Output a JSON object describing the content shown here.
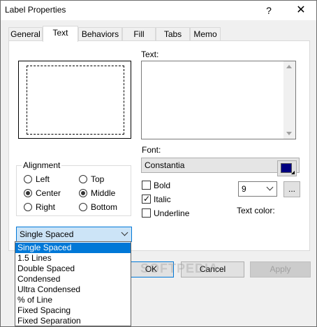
{
  "window": {
    "title": "Label Properties",
    "help_label": "?",
    "close_label": "✕"
  },
  "tabs": [
    {
      "label": "General"
    },
    {
      "label": "Text"
    },
    {
      "label": "Behaviors"
    },
    {
      "label": "Fill"
    },
    {
      "label": "Tabs"
    },
    {
      "label": "Memo"
    }
  ],
  "active_tab": "Text",
  "text_section": {
    "label": "Text:",
    "value": ""
  },
  "alignment": {
    "title": "Alignment",
    "options": {
      "left": "Left",
      "top": "Top",
      "center": "Center",
      "middle": "Middle",
      "right": "Right",
      "bottom": "Bottom"
    },
    "selected_horizontal": "Center",
    "selected_vertical": "Middle"
  },
  "font": {
    "label": "Font:",
    "name": "Constantia",
    "size": "9",
    "browse_label": "...",
    "bold_label": "Bold",
    "bold_checked": false,
    "italic_label": "Italic",
    "italic_checked": true,
    "underline_label": "Underline",
    "underline_checked": false,
    "text_color_label": "Text color:",
    "text_color": "#000080"
  },
  "spacing": {
    "selected": "Single Spaced",
    "options": [
      "Single Spaced",
      "1.5 Lines",
      "Double Spaced",
      "Condensed",
      "Ultra Condensed",
      "% of Line",
      "Fixed Spacing",
      "Fixed Separation"
    ]
  },
  "buttons": {
    "ok": "OK",
    "cancel": "Cancel",
    "apply": "Apply"
  },
  "watermark": "SOFTPEDIA",
  "colors": {
    "accent": "#0078d7",
    "dialog_bg": "#f0f0f0"
  }
}
